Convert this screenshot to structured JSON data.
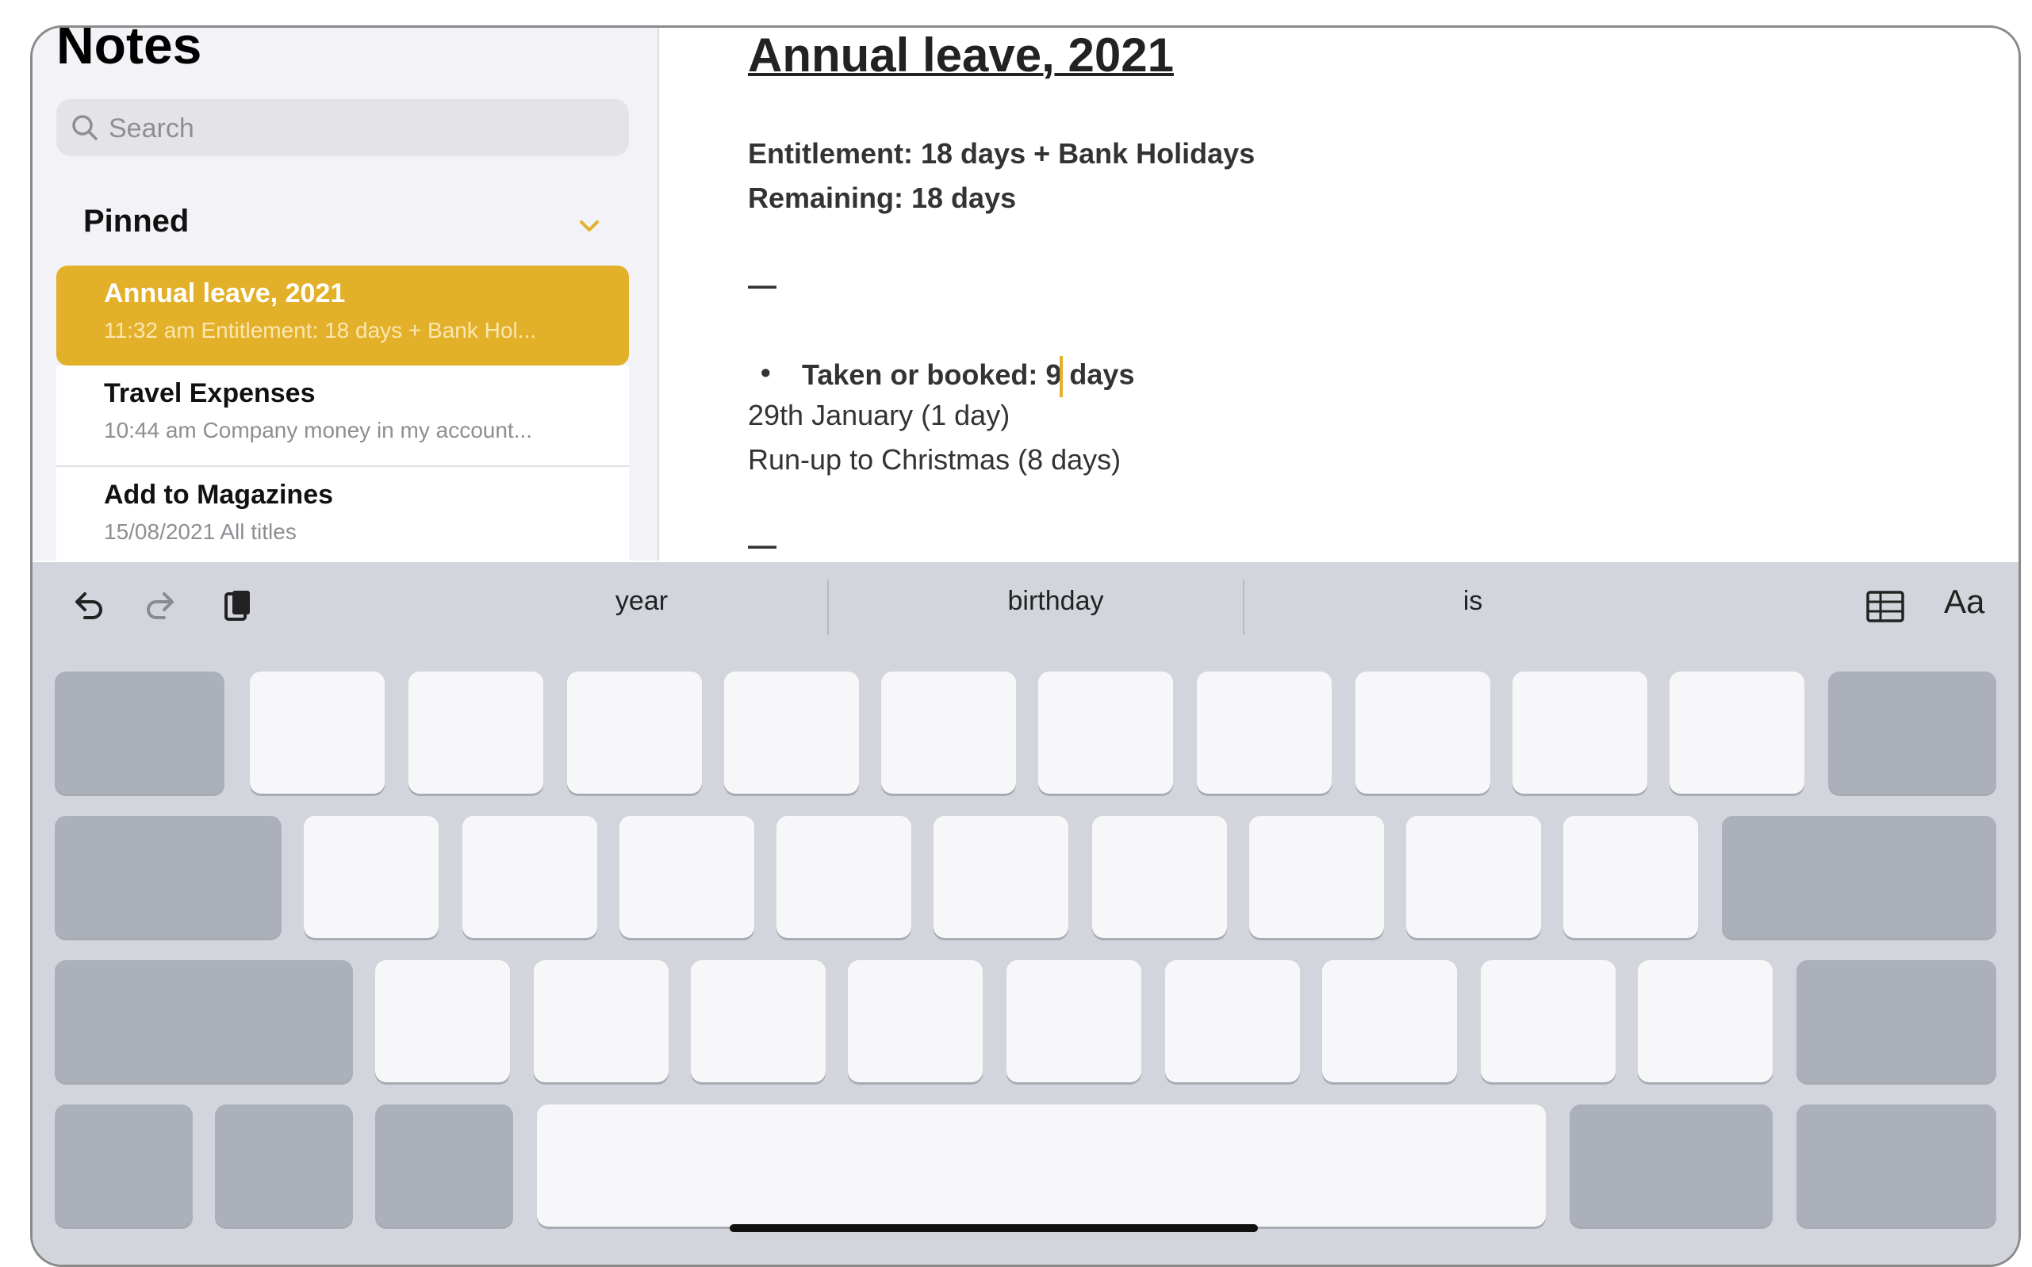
{
  "sidebar": {
    "title": "Notes",
    "search_placeholder": "Search",
    "section_label": "Pinned",
    "notes": [
      {
        "title": "Annual leave, 2021",
        "meta": "11:32 am  Entitlement: 18 days + Bank Hol..."
      },
      {
        "title": "Travel Expenses",
        "meta": "10:44 am  Company money in my account..."
      },
      {
        "title": "Add to Magazines",
        "meta": "15/08/2021  All titles"
      }
    ]
  },
  "editor": {
    "title": "Annual leave, 2021",
    "entitlement": "Entitlement: 18 days + Bank Holidays",
    "remaining": "Remaining: 18 days",
    "dash1": "—",
    "bullet_before_cursor": "Taken or booked: 9",
    "bullet_after_cursor": " days",
    "entry1": "29th January (1 day)",
    "entry2": "Run-up to Christmas (8 days)",
    "dash2": "—"
  },
  "keyboard": {
    "suggestions": [
      "year",
      "birthday",
      "is"
    ],
    "format_label": "Aa",
    "icons": [
      "undo-icon",
      "redo-icon",
      "paste-icon",
      "table-icon"
    ]
  },
  "colors": {
    "accent": "#e3b02a",
    "keyboard_bg": "#d3d5dc",
    "key_light": "#f7f7f9",
    "key_dark": "#abb0bb",
    "sidebar_bg": "#f2f2f7"
  }
}
